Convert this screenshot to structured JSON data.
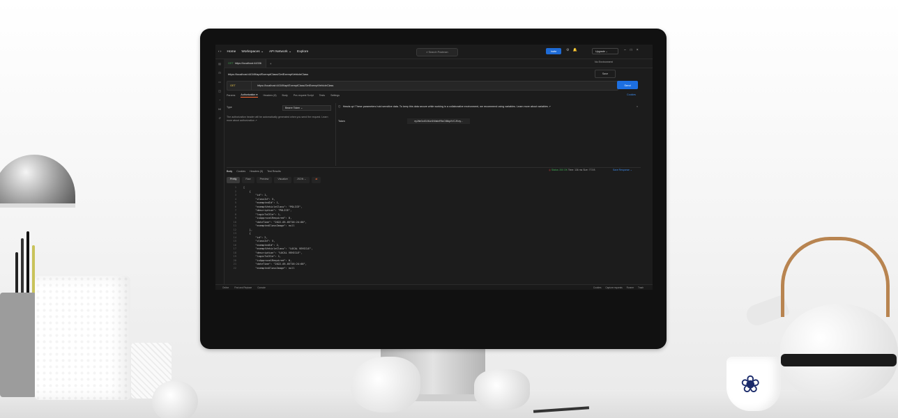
{
  "app": {
    "nav": [
      "Home",
      "Workspaces ⌄",
      "API Network ⌄",
      "Explore"
    ],
    "search_placeholder": "Search Postman",
    "invite_label": "Invite",
    "upgrade_label": "Upgrade ⌄",
    "environment": "No Environment"
  },
  "tab": {
    "method": "GET",
    "label": "https://localhost:44336"
  },
  "request": {
    "title": "https://localhost:44349/api/ExemptClass/GetExemptVehicleClass",
    "method": "GET",
    "url": "https://localhost:44349/api/ExemptClass/GetExemptVehicleClass",
    "send_label": "Send",
    "save_label": "Save",
    "tabs": [
      "Params",
      "Authorization ●",
      "Headers (8)",
      "Body",
      "Pre-request Script",
      "Tests",
      "Settings"
    ],
    "cookies_label": "Cookies"
  },
  "auth": {
    "type_label": "Type",
    "type_value": "Bearer Token ⌄",
    "note": "The authorization header will be automatically generated when you send the request. Learn more about authorization ↗",
    "banner": "Heads up! These parameters hold sensitive data. To keep this data secure while working in a collaborative environment, we recommend using variables. Learn more about variables ↗",
    "token_label": "Token",
    "token_value": "eyJhbGciOiJIUzI1NiIsInR5cCI6IkpXVCJ9.ey..."
  },
  "response": {
    "tabs": [
      "Body",
      "Cookies",
      "Headers (5)",
      "Test Results"
    ],
    "status": "Status: 200 OK",
    "time": "Time: 136 ms",
    "size": "Size: 773 B",
    "save_response": "Save Response ⌄",
    "formats": [
      "Pretty",
      "Raw",
      "Preview",
      "Visualize",
      "JSON ⌄"
    ],
    "lines": [
      {
        "n": "1",
        "t": "["
      },
      {
        "n": "2",
        "t": "    {"
      },
      {
        "n": "3",
        "t": "        \"id\": 1,"
      },
      {
        "n": "4",
        "t": "        \"classId\": 5,"
      },
      {
        "n": "5",
        "t": "        \"exemptedId\": 1,"
      },
      {
        "n": "6",
        "t": "        \"exemptVehicleClass\": \"POLICE\","
      },
      {
        "n": "7",
        "t": "        \"description\": \"POLICE\","
      },
      {
        "n": "8",
        "t": "        \"logicToCSle\": 1,"
      },
      {
        "n": "9",
        "t": "        \"isApprovalRequired\": 0,"
      },
      {
        "n": "10",
        "t": "        \"dateTime\": \"2022-05-05T16:24:00\","
      },
      {
        "n": "11",
        "t": "        \"exemptedClassImage\": null"
      },
      {
        "n": "12",
        "t": "    },"
      },
      {
        "n": "13",
        "t": "    {"
      },
      {
        "n": "14",
        "t": "        \"id\": 2,"
      },
      {
        "n": "15",
        "t": "        \"classId\": 5,"
      },
      {
        "n": "16",
        "t": "        \"exemptedId\": 2,"
      },
      {
        "n": "17",
        "t": "        \"exemptVehicleClass\": \"LOCAL VEHICLE\","
      },
      {
        "n": "18",
        "t": "        \"description\": \"LOCAL VEHICLE\","
      },
      {
        "n": "19",
        "t": "        \"logicToCSle\": 1,"
      },
      {
        "n": "20",
        "t": "        \"isApprovalRequired\": 0,"
      },
      {
        "n": "21",
        "t": "        \"dateTime\": \"2022-05-05T16:24:00\","
      },
      {
        "n": "22",
        "t": "        \"exemptedClassImage\": null"
      }
    ]
  },
  "footer": {
    "left": [
      "Online",
      "Find and Replace",
      "Console"
    ],
    "right": [
      "Cookies",
      "Capture requests",
      "Runner",
      "Trash"
    ]
  }
}
